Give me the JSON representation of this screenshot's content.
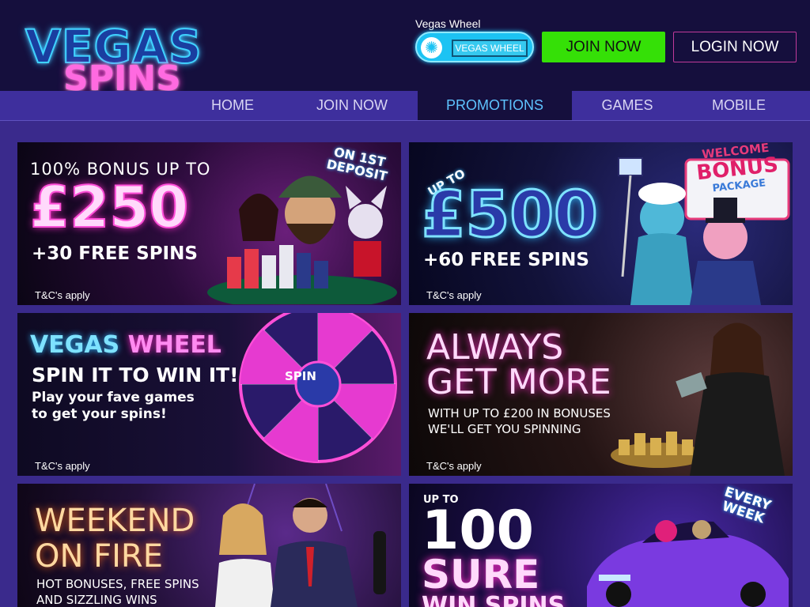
{
  "header": {
    "logo_top": "VEGAS",
    "logo_bottom": "SPINS",
    "vegas_wheel_label": "Vegas Wheel",
    "vegas_wheel_button": "VEGAS WHEEL",
    "join_button": "JOIN NOW",
    "login_button": "LOGIN NOW"
  },
  "nav": {
    "items": [
      "HOME",
      "JOIN NOW",
      "PROMOTIONS",
      "GAMES",
      "MOBILE"
    ],
    "active": "PROMOTIONS"
  },
  "promos": {
    "p1": {
      "corner": "ON 1ST",
      "corner2": "DEPOSIT",
      "line1": "100% BONUS UP TO",
      "amount": "£250",
      "line2": "+30 FREE SPINS",
      "tc": "T&C's apply"
    },
    "p2": {
      "up_to": "UP TO",
      "amount": "£500",
      "line2": "+60 FREE SPINS",
      "sign1": "WELCOME",
      "sign2": "BONUS",
      "sign3": "PACKAGE",
      "tc": "T&C's apply"
    },
    "p3": {
      "title_a": "VEGAS",
      "title_b": "WHEEL",
      "line1": "SPIN IT TO WIN IT!",
      "line2": "Play your fave games",
      "line3": "to get your spins!",
      "wheel_center": "SPIN",
      "tc": "T&C's apply"
    },
    "p4": {
      "line1": "ALWAYS",
      "line2": "GET MORE",
      "line3": "WITH UP TO £200 IN BONUSES",
      "line4": "WE'LL GET YOU SPINNING",
      "tc": "T&C's apply"
    },
    "p5": {
      "line1": "WEEKEND",
      "line2": "ON FIRE",
      "line3": "HOT BONUSES, FREE SPINS",
      "line4": "AND SIZZLING WINS"
    },
    "p6": {
      "up_to": "UP TO",
      "amount": "100",
      "line2": "SURE",
      "line3": "WIN SPINS",
      "corner": "EVERY",
      "corner2": "WEEK"
    }
  },
  "colors": {
    "page_bg": "#3a2a8c",
    "header_bg": "#150f3d",
    "join_green": "#35e007",
    "login_border": "#c13a9a",
    "nav_active_text": "#5ec3ff"
  }
}
